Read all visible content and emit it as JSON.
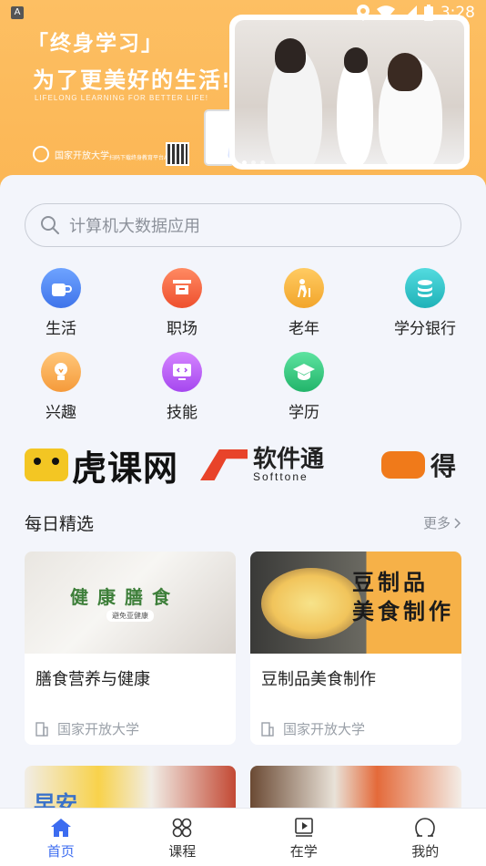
{
  "status_bar": {
    "time": "3:28",
    "notification_glyph": "A"
  },
  "banner": {
    "quote": "「终身学习」",
    "title": "为了更美好的生活!",
    "subtitle": "LIFELONG LEARNING FOR BETTER LIFE!",
    "logo_text": "国家开放大学",
    "tagline": "扫码下载终身教育平台APP"
  },
  "search": {
    "placeholder": "计算机大数据应用"
  },
  "categories": [
    {
      "label": "生活",
      "icon": "cup-icon",
      "color": "#4a86f0"
    },
    {
      "label": "职场",
      "icon": "podium-icon",
      "color": "#f0623c"
    },
    {
      "label": "老年",
      "icon": "elder-icon",
      "color": "#f5b33a"
    },
    {
      "label": "学分银行",
      "icon": "coins-icon",
      "color": "#2fc4c9"
    },
    {
      "label": "兴趣",
      "icon": "bulb-icon",
      "color": "#f7a13c"
    },
    {
      "label": "技能",
      "icon": "monitor-icon",
      "color": "#b65cf0"
    },
    {
      "label": "学历",
      "icon": "graduation-cap-icon",
      "color": "#34c27a"
    }
  ],
  "partners": [
    {
      "name": "虎课网"
    },
    {
      "name_cn": "软件通",
      "name_en": "Softtone"
    },
    {
      "name": "得"
    }
  ],
  "daily": {
    "title": "每日精选",
    "more": "更多",
    "cards": [
      {
        "title": "膳食营养与健康",
        "source": "国家开放大学",
        "image_text": "健康膳食",
        "image_sub": "避免亚健康"
      },
      {
        "title": "豆制品美食制作",
        "source": "国家开放大学",
        "image_text_line1": "豆制品",
        "image_text_line2": "美食制作"
      },
      {
        "title": "",
        "image_text": "早安"
      },
      {
        "title": ""
      }
    ]
  },
  "tabbar": [
    {
      "label": "首页",
      "icon": "home-icon",
      "active": true
    },
    {
      "label": "课程",
      "icon": "grid-icon",
      "active": false
    },
    {
      "label": "在学",
      "icon": "play-book-icon",
      "active": false
    },
    {
      "label": "我的",
      "icon": "person-icon",
      "active": false
    }
  ],
  "colors": {
    "accent": "#3c6cf0",
    "banner": "#fbb654",
    "background": "#f3f5fb"
  }
}
